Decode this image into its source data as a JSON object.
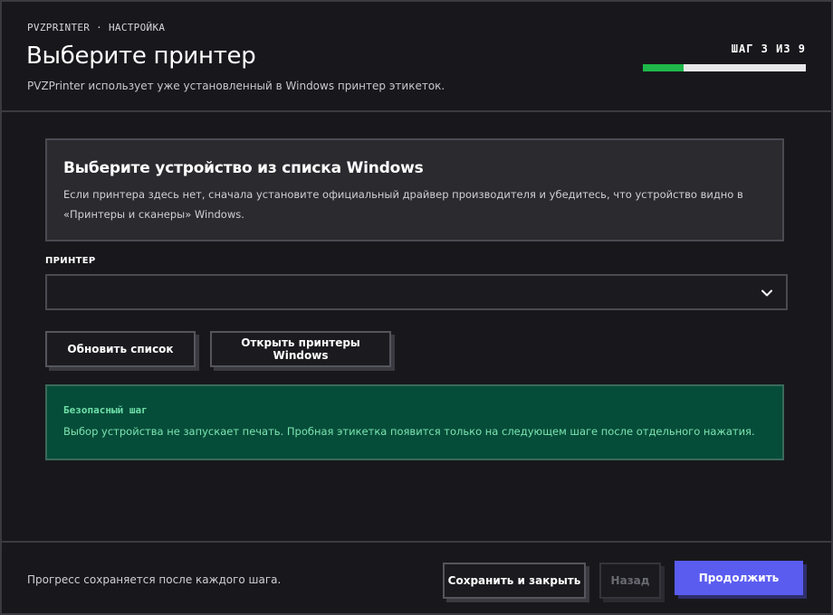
{
  "header": {
    "eyebrow": "PVZPRINTER · НАСТРОЙКА",
    "title": "Выберите принтер",
    "subtitle": "PVZPrinter использует уже установленный в Windows принтер этикеток.",
    "step_label": "ШАГ 3 ИЗ 9",
    "progress": {
      "current": 3,
      "total": 9,
      "fraction": 0.25,
      "fill_color": "#1fb84a",
      "track_color": "#e8e8ea"
    }
  },
  "info_card": {
    "title": "Выберите устройство из списка Windows",
    "text": "Если принтера здесь нет, сначала установите официальный драйвер производителя и убедитесь, что устройство видно в «Принтеры и сканеры» Windows."
  },
  "printer_field": {
    "label": "ПРИНТЕР",
    "selected_value": "",
    "icon": "chevron-down-icon"
  },
  "actions": {
    "refresh_label": "Обновить список",
    "open_printers_label": "Открыть принтеры Windows"
  },
  "safe_notice": {
    "title": "Безопасный шаг",
    "text": "Выбор устройства не запускает печать. Пробная этикетка появится только на следующем шаге после отдельного нажатия.",
    "bg_color": "#064d39",
    "text_color": "#7be5b1"
  },
  "footer": {
    "note": "Прогресс сохраняется после каждого шага.",
    "save_close_label": "Сохранить и закрыть",
    "back_label": "Назад",
    "continue_label": "Продолжить",
    "accent_color": "#5a5cf0"
  }
}
